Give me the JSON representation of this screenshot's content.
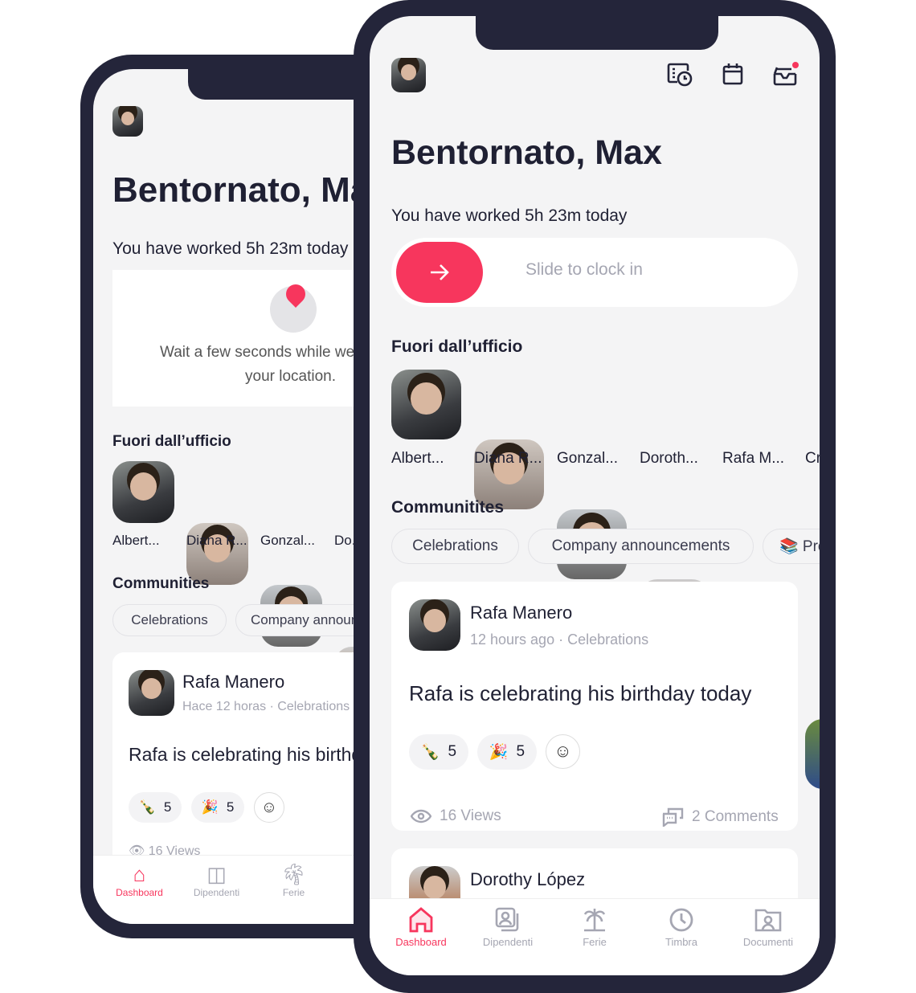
{
  "back": {
    "greeting": "Bentornato, Max",
    "worked": "You have worked 5h 23m today",
    "location_msg_1": "Wait a few seconds while we",
    "location_msg_2": "your location.",
    "ooo_title": "Fuori dall’ufficio",
    "people": [
      "Albert...",
      "Diana R...",
      "Gonzal...",
      "Do..."
    ],
    "communities_title": "Communities",
    "chips": [
      "Celebrations",
      "Company announcements"
    ],
    "post": {
      "author": "Rafa Manero",
      "time": "Hace 12 horas",
      "community": "Celebrations",
      "text": "Rafa is celebrating his birthday today",
      "reactions": [
        {
          "emoji": "🍾",
          "count": "5"
        },
        {
          "emoji": "🎉",
          "count": "5"
        }
      ],
      "views": "16 Views"
    },
    "nav": [
      "Dashboard",
      "Dipendenti",
      "Ferie"
    ]
  },
  "front": {
    "greeting": "Bentornato, Max",
    "worked": "You have worked 5h 23m today",
    "slide_label": "Slide to clock in",
    "ooo_title": "Fuori dall’ufficio",
    "people": [
      "Albert...",
      "Diana R...",
      "Gonzal...",
      "Doroth...",
      "Rafa M...",
      "Cr..."
    ],
    "communities_title": "Communitites",
    "chips": [
      "Celebrations",
      "Company announcements",
      "📚 Pro..."
    ],
    "post": {
      "author": "Rafa Manero",
      "time": "12 hours ago",
      "community": "Celebrations",
      "text": "Rafa is celebrating his birthday today",
      "reactions": [
        {
          "emoji": "🍾",
          "count": "5"
        },
        {
          "emoji": "🎉",
          "count": "5"
        }
      ],
      "views": "16 Views",
      "comments": "2 Comments"
    },
    "post2": {
      "author": "Dorothy López"
    },
    "nav": [
      "Dashboard",
      "Dipendenti",
      "Ferie",
      "Timbra",
      "Documenti"
    ],
    "icons": [
      "timesheet-icon",
      "calendar-icon",
      "inbox-icon"
    ]
  },
  "colors": {
    "accent": "#f7365d",
    "frame": "#24253a",
    "background": "#f4f4f5"
  }
}
